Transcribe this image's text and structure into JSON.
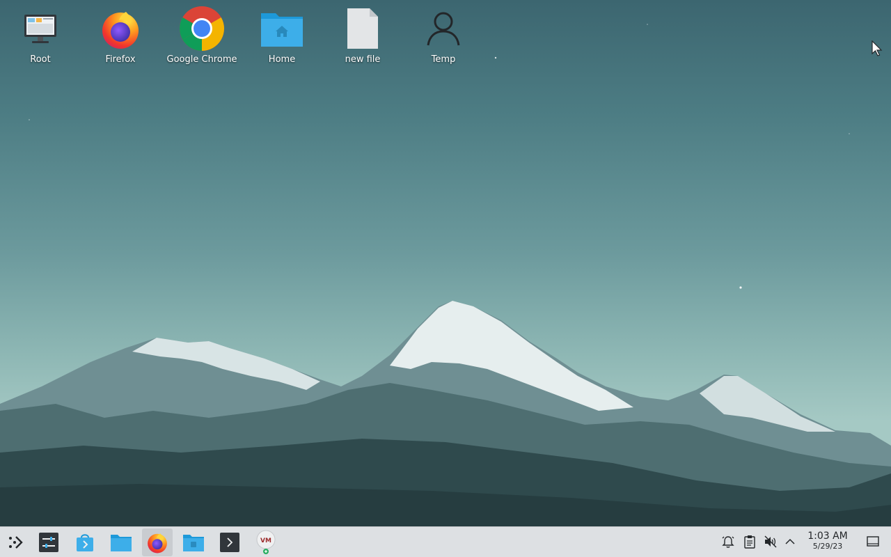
{
  "desktop": {
    "icons": [
      {
        "label": "Root",
        "icon": "computer-icon"
      },
      {
        "label": "Firefox",
        "icon": "firefox-icon"
      },
      {
        "label": "Google Chrome",
        "icon": "chrome-icon"
      },
      {
        "label": "Home",
        "icon": "home-folder-icon"
      },
      {
        "label": "new file",
        "icon": "file-icon"
      },
      {
        "label": "Temp",
        "icon": "user-icon"
      }
    ]
  },
  "taskbar": {
    "launchers": [
      {
        "name": "application-launcher",
        "icon": "launcher-icon"
      },
      {
        "name": "system-settings",
        "icon": "settings-icon"
      },
      {
        "name": "discover-store",
        "icon": "store-icon"
      },
      {
        "name": "file-manager",
        "icon": "folder-icon"
      },
      {
        "name": "firefox",
        "icon": "firefox-icon"
      },
      {
        "name": "files",
        "icon": "folder-icon"
      },
      {
        "name": "terminal",
        "icon": "terminal-icon"
      },
      {
        "name": "virt-manager",
        "icon": "vm-icon"
      }
    ],
    "tray": {
      "icons": [
        "notifications-icon",
        "clipboard-icon",
        "volume-muted-icon",
        "chevron-up-icon"
      ],
      "clock_time": "1:03 AM",
      "clock_date": "5/29/23"
    },
    "show_desktop_icon": "show-desktop-icon"
  },
  "colors": {
    "taskbar_bg": "#dde0e3",
    "folder_blue": "#3daee9",
    "sky_top": "#3c6670",
    "sky_bottom": "#a5c9c4"
  }
}
